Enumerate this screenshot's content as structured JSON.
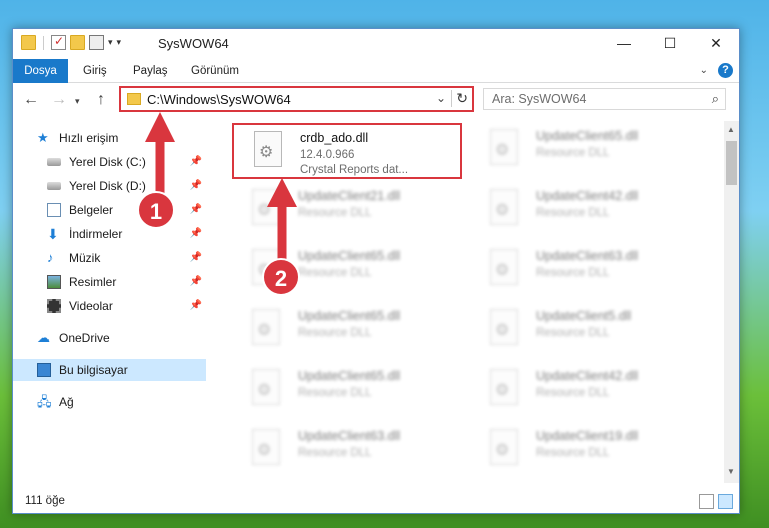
{
  "window": {
    "title": "SysWOW64"
  },
  "ribbon": {
    "tabs": [
      "Dosya",
      "Giriş",
      "Paylaş",
      "Görünüm"
    ]
  },
  "nav": {
    "address": "C:\\Windows\\SysWOW64",
    "search_placeholder": "Ara: SysWOW64"
  },
  "sidebar": {
    "items": [
      {
        "label": "Hızlı erişim"
      },
      {
        "label": "Yerel Disk (C:)"
      },
      {
        "label": "Yerel Disk (D:)"
      },
      {
        "label": "Belgeler"
      },
      {
        "label": "İndirmeler"
      },
      {
        "label": "Müzik"
      },
      {
        "label": "Resimler"
      },
      {
        "label": "Videolar"
      },
      {
        "label": "OneDrive"
      },
      {
        "label": "Bu bilgisayar"
      },
      {
        "label": "Ağ"
      }
    ]
  },
  "files": {
    "highlighted": {
      "name": "crdb_ado.dll",
      "version": "12.4.0.966",
      "desc": "Crystal Reports dat..."
    },
    "col1": [
      {
        "name": "UpdateClient21.dll",
        "desc": "Resource DLL"
      },
      {
        "name": "UpdateClient65.dll",
        "desc": "Resource DLL"
      },
      {
        "name": "UpdateClient65.dll",
        "desc": "Resource DLL"
      },
      {
        "name": "UpdateClient65.dll",
        "desc": "Resource DLL"
      },
      {
        "name": "UpdateClient63.dll",
        "desc": "Resource DLL"
      }
    ],
    "col2": [
      {
        "name": "UpdateClient65.dll",
        "desc": "Resource DLL"
      },
      {
        "name": "UpdateClient42.dll",
        "desc": "Resource DLL"
      },
      {
        "name": "UpdateClient63.dll",
        "desc": "Resource DLL"
      },
      {
        "name": "UpdateClient5.dll",
        "desc": "Resource DLL"
      },
      {
        "name": "UpdateClient42.dll",
        "desc": "Resource DLL"
      },
      {
        "name": "UpdateClient19.dll",
        "desc": "Resource DLL"
      }
    ]
  },
  "status": {
    "count": "111 öğe"
  },
  "annotations": {
    "badge1": "1",
    "badge2": "2",
    "color": "#d9363e"
  }
}
